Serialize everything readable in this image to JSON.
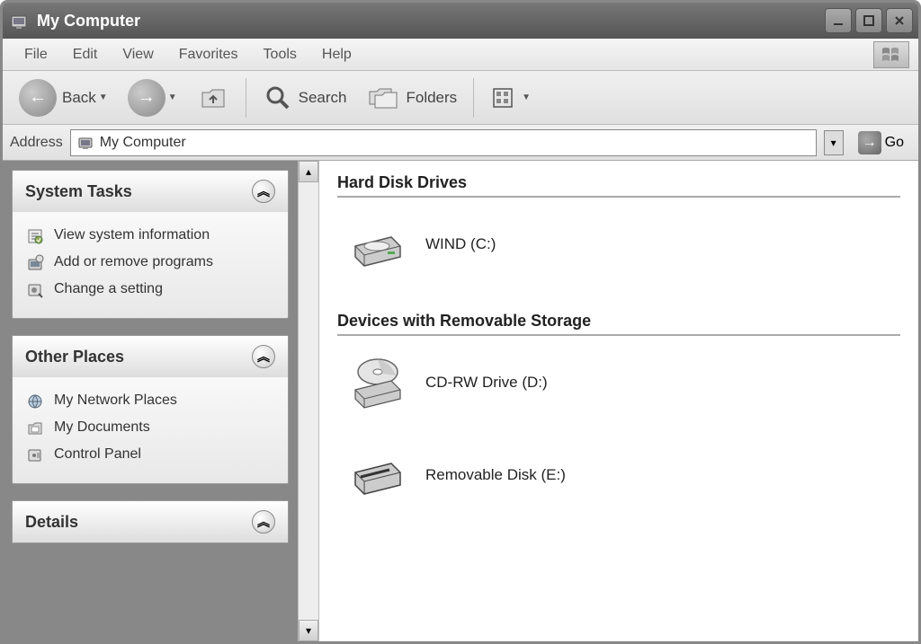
{
  "window": {
    "title": "My Computer"
  },
  "menubar": {
    "items": [
      "File",
      "Edit",
      "View",
      "Favorites",
      "Tools",
      "Help"
    ]
  },
  "toolbar": {
    "back_label": "Back",
    "search_label": "Search",
    "folders_label": "Folders"
  },
  "addressbar": {
    "label": "Address",
    "value": "My Computer",
    "go_label": "Go"
  },
  "sidebar": {
    "panels": [
      {
        "title": "System Tasks",
        "items": [
          {
            "label": "View system information",
            "icon": "info-icon"
          },
          {
            "label": "Add or remove programs",
            "icon": "programs-icon"
          },
          {
            "label": "Change a setting",
            "icon": "settings-icon"
          }
        ]
      },
      {
        "title": "Other Places",
        "items": [
          {
            "label": "My Network Places",
            "icon": "network-icon"
          },
          {
            "label": "My Documents",
            "icon": "documents-icon"
          },
          {
            "label": "Control Panel",
            "icon": "control-panel-icon"
          }
        ]
      },
      {
        "title": "Details",
        "items": []
      }
    ]
  },
  "main": {
    "sections": [
      {
        "title": "Hard Disk Drives",
        "drives": [
          {
            "label": "WIND (C:)",
            "icon": "hdd-icon"
          }
        ]
      },
      {
        "title": "Devices with Removable Storage",
        "drives": [
          {
            "label": "CD-RW Drive (D:)",
            "icon": "cdrom-icon"
          },
          {
            "label": "Removable Disk (E:)",
            "icon": "removable-icon"
          }
        ]
      }
    ]
  }
}
